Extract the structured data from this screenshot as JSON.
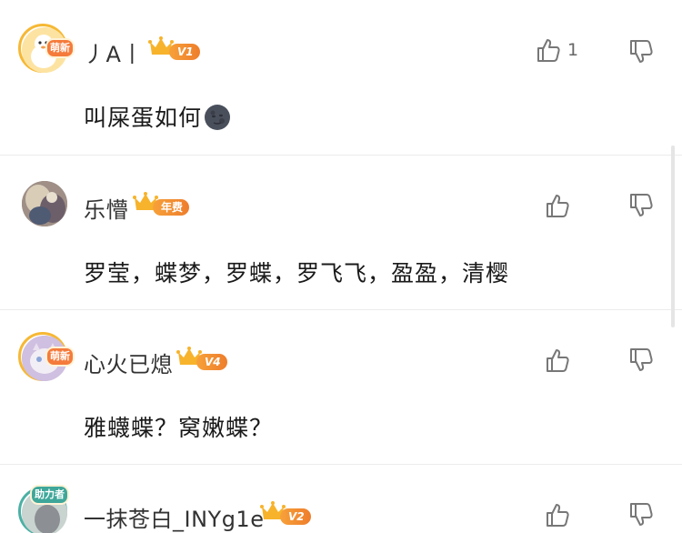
{
  "comments": [
    {
      "username": "丿A丨",
      "badge": "V1",
      "frame_tag": "萌新",
      "like_count": "1",
      "text": "叫屎蛋如何"
    },
    {
      "username": "乐懵",
      "badge": "年费",
      "frame_tag": "",
      "like_count": "",
      "text": "罗莹，蝶梦，罗蝶，罗飞飞，盈盈，清樱"
    },
    {
      "username": "心火已熄",
      "badge": "V4",
      "frame_tag": "萌新",
      "like_count": "",
      "text": "雅蠛蝶？窝嫩蝶？"
    },
    {
      "username": "一抹苍白_INYg1e",
      "badge": "V2",
      "frame_tag": "助力者",
      "like_count": "",
      "text": ""
    }
  ],
  "icons": {
    "like": "thumbs-up-icon",
    "dislike": "thumbs-down-icon",
    "vip": "crown-icon",
    "emoji": "new-moon-face-emoji"
  },
  "colors": {
    "badge_orange": "#f08a2e",
    "crown_gold": "#f7b32b",
    "divider": "#ececec"
  }
}
